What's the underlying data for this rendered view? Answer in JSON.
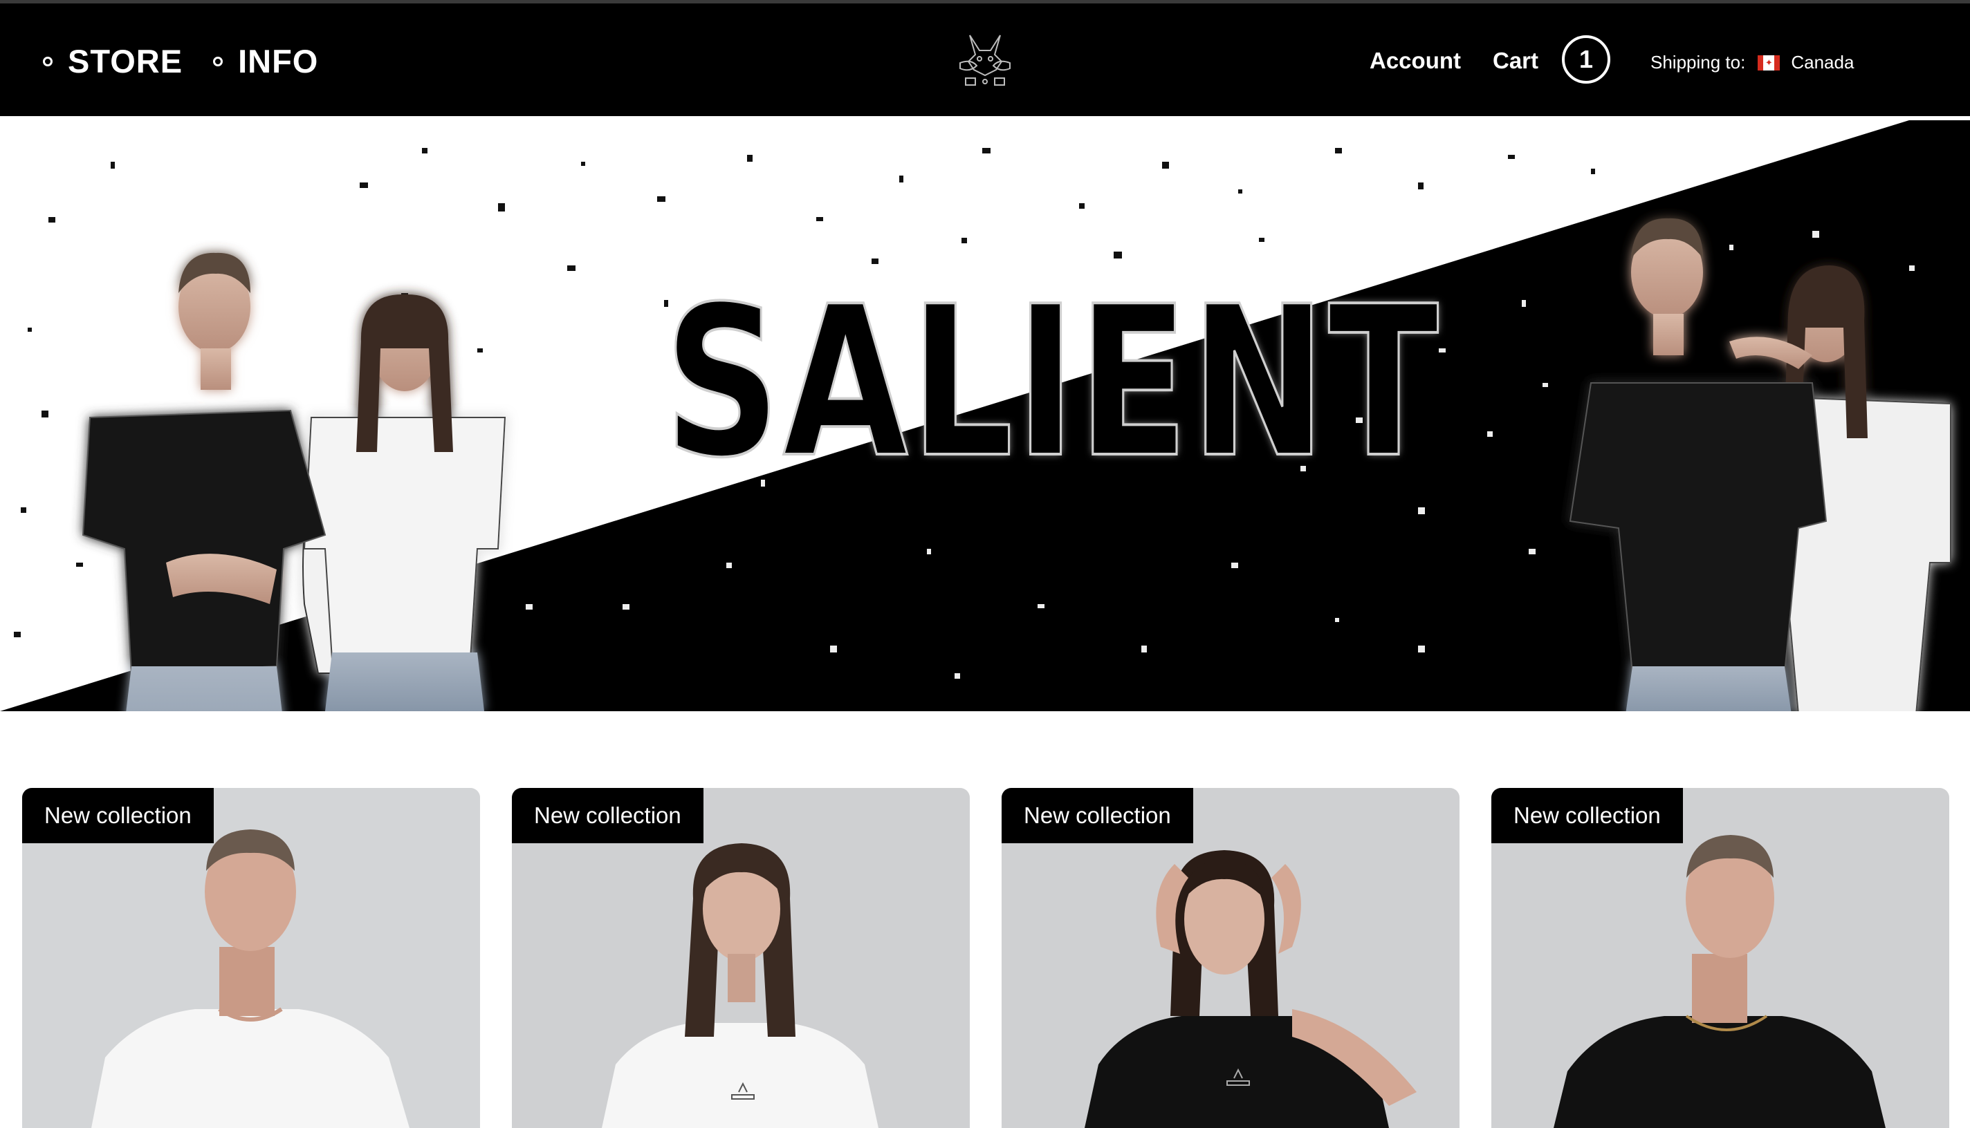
{
  "header": {
    "nav": [
      {
        "label": "STORE"
      },
      {
        "label": "INFO"
      }
    ],
    "logo_icon": "doberman-logo-icon",
    "account_label": "Account",
    "cart_label": "Cart",
    "cart_count": "1",
    "shipping_label": "Shipping to:",
    "country": "Canada",
    "flag_icon": "canada-flag-icon"
  },
  "hero": {
    "title": "SALIENT"
  },
  "products": [
    {
      "badge": "New collection",
      "shirt_color": "white",
      "model": "man"
    },
    {
      "badge": "New collection",
      "shirt_color": "white",
      "model": "woman"
    },
    {
      "badge": "New collection",
      "shirt_color": "black",
      "model": "woman"
    },
    {
      "badge": "New collection",
      "shirt_color": "black",
      "model": "man"
    }
  ],
  "colors": {
    "header_bg": "#000000",
    "text_on_dark": "#ffffff",
    "card_bg": "#cfd0d2",
    "badge_bg": "#000000"
  }
}
